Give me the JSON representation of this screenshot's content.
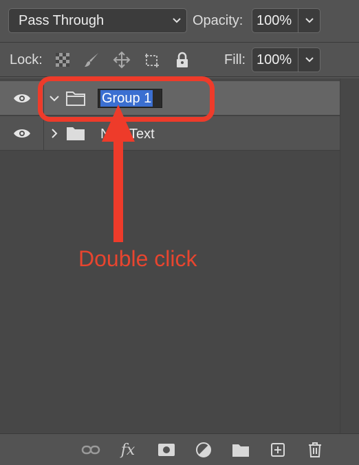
{
  "blend_mode": {
    "value": "Pass Through"
  },
  "opacity": {
    "label": "Opacity:",
    "value": "100%"
  },
  "lock": {
    "label": "Lock:"
  },
  "fill": {
    "label": "Fill:",
    "value": "100%"
  },
  "layers": [
    {
      "name": "Group 1",
      "expanded": true,
      "selected": true,
      "editing": true,
      "visible": true
    },
    {
      "name": "New Text",
      "expanded": false,
      "selected": false,
      "editing": false,
      "visible": true
    }
  ],
  "layer_row2_visible_text": "N",
  "layer_row2_visible_text_tail": "Text",
  "bottom_toolbar": {
    "fx_label": "fx"
  },
  "annotation": {
    "text": "Double click",
    "color": "#ee3b2a"
  },
  "colors": {
    "panel": "#535353",
    "selected_row": "#656565",
    "selection_highlight": "#3b6fd1"
  }
}
